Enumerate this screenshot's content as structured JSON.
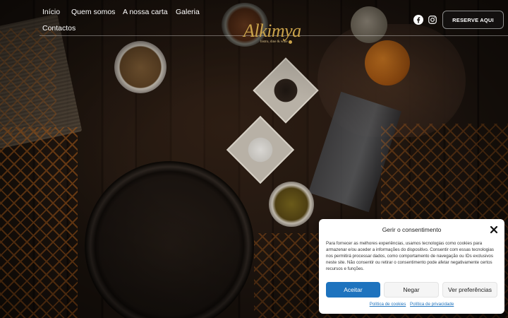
{
  "nav": {
    "items": [
      "Início",
      "Quem somos",
      "A nossa carta",
      "Galeria",
      "Contactos"
    ]
  },
  "logo": {
    "word": "Alkimya",
    "tagline": "bistro, dine & wine"
  },
  "header": {
    "social_icons": [
      "facebook-icon",
      "instagram-icon"
    ],
    "reserve_label": "RESERVE AQUI"
  },
  "consent": {
    "title": "Gerir o consentimento",
    "body": "Para fornecer as melhores experiências, usamos tecnologias como cookies para armazenar e/ou aceder a informações do dispositivo. Consentir com essas tecnologias nos permitirá processar dados, como comportamento de navegação ou IDs exclusivos neste site. Não consentir ou retirar o consentimento pode afetar negativamente certos recursos e funções.",
    "accept": "Aceitar",
    "deny": "Negar",
    "preferences": "Ver preferências",
    "cookie_policy": "Política de cookies",
    "privacy_policy": "Política de privacidade"
  },
  "colors": {
    "accent": "#1e73be",
    "logo_gold": "#c9a24a",
    "pattern_orange": "#c46a1e"
  }
}
